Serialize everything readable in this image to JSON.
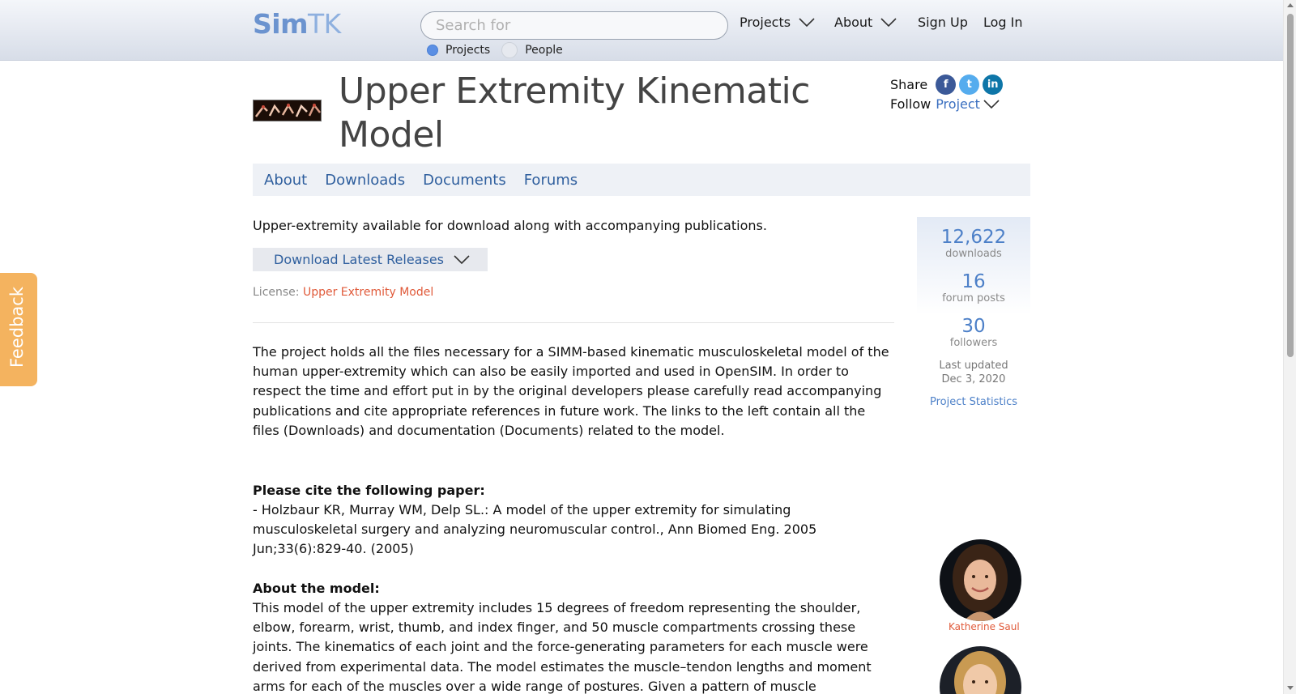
{
  "header": {
    "logo_sim": "Sim",
    "logo_tk": "TK",
    "search_placeholder": "Search for",
    "radio_projects": "Projects",
    "radio_people": "People",
    "nav_projects": "Projects",
    "nav_about": "About",
    "nav_signup": "Sign Up",
    "nav_login": "Log In"
  },
  "project": {
    "title": "Upper Extremity Kinematic Model",
    "share_label": "Share",
    "follow_label": "Follow",
    "follow_link": "Project"
  },
  "tabs": [
    "About",
    "Downloads",
    "Documents",
    "Forums"
  ],
  "main": {
    "summary": "Upper-extremity available for download along with accompanying publications.",
    "download_button": "Download Latest Releases",
    "license_label": "License:",
    "license_link": "Upper Extremity Model",
    "description": "The project holds all the files necessary for a SIMM-based kinematic musculoskeletal model of the human upper-extremity which can also be easily imported and used in OpenSIM. In order to respect the time and effort put in by the original developers please carefully read accompanying publications and cite appropriate references in future work. The links to the left contain all the files (Downloads) and documentation (Documents) related to the model.",
    "cite_heading": "Please cite the following paper:",
    "cite_text": "- Holzbaur KR, Murray WM, Delp SL.: A model of the upper extremity for simulating musculoskeletal surgery and analyzing neuromuscular control., Ann Biomed Eng. 2005 Jun;33(6):829-40. (2005)",
    "about_heading": "About the model:",
    "about_text": "This model of the upper extremity includes 15 degrees of freedom representing the shoulder, elbow, forearm, wrist, thumb, and index finger, and 50 muscle compartments crossing these joints. The kinematics of each joint and the force-generating parameters for each muscle were derived from experimental data. The model estimates the muscle–tendon lengths and moment arms for each of the muscles over a wide range of postures. Given a pattern of muscle activations, the model"
  },
  "stats": {
    "downloads": "12,622",
    "downloads_label": "downloads",
    "forum_posts": "16",
    "forum_posts_label": "forum posts",
    "followers": "30",
    "followers_label": "followers",
    "updated_label": "Last updated",
    "updated_date": "Dec 3, 2020",
    "stats_link": "Project Statistics"
  },
  "people": {
    "person1_name": "Katherine Saul"
  },
  "feedback_label": "Feedback",
  "icons": {
    "facebook": "f",
    "twitter": "t",
    "linkedin": "in"
  },
  "colors": {
    "link_blue": "#2f5f9e",
    "accent_orange": "#e05a3a",
    "feedback_tab": "#f4b35f",
    "facebook": "#3b5998",
    "twitter": "#55acee",
    "linkedin": "#0e76a8"
  }
}
